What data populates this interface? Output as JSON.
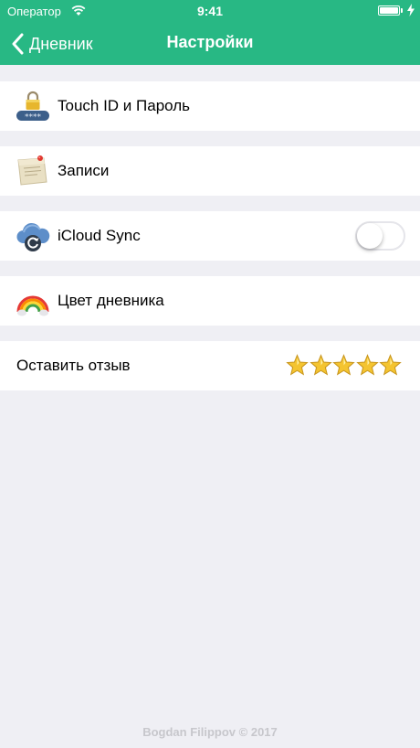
{
  "status_bar": {
    "carrier": "Оператор",
    "time": "9:41"
  },
  "nav": {
    "back_label": "Дневник",
    "title": "Настройки"
  },
  "rows": [
    {
      "label": "Touch ID и Пароль",
      "icon": "lock-password-icon"
    },
    {
      "label": "Записи",
      "icon": "note-paper-icon"
    },
    {
      "label": "iCloud Sync",
      "icon": "icloud-sync-icon",
      "toggle_on": false
    },
    {
      "label": "Цвет дневника",
      "icon": "rainbow-icon"
    },
    {
      "label": "Оставить отзыв",
      "rating_stars": 5
    }
  ],
  "footer": "Bogdan Filippov © 2017",
  "colors": {
    "accent": "#28b884",
    "background": "#efeff4",
    "star": "#f4c430"
  }
}
